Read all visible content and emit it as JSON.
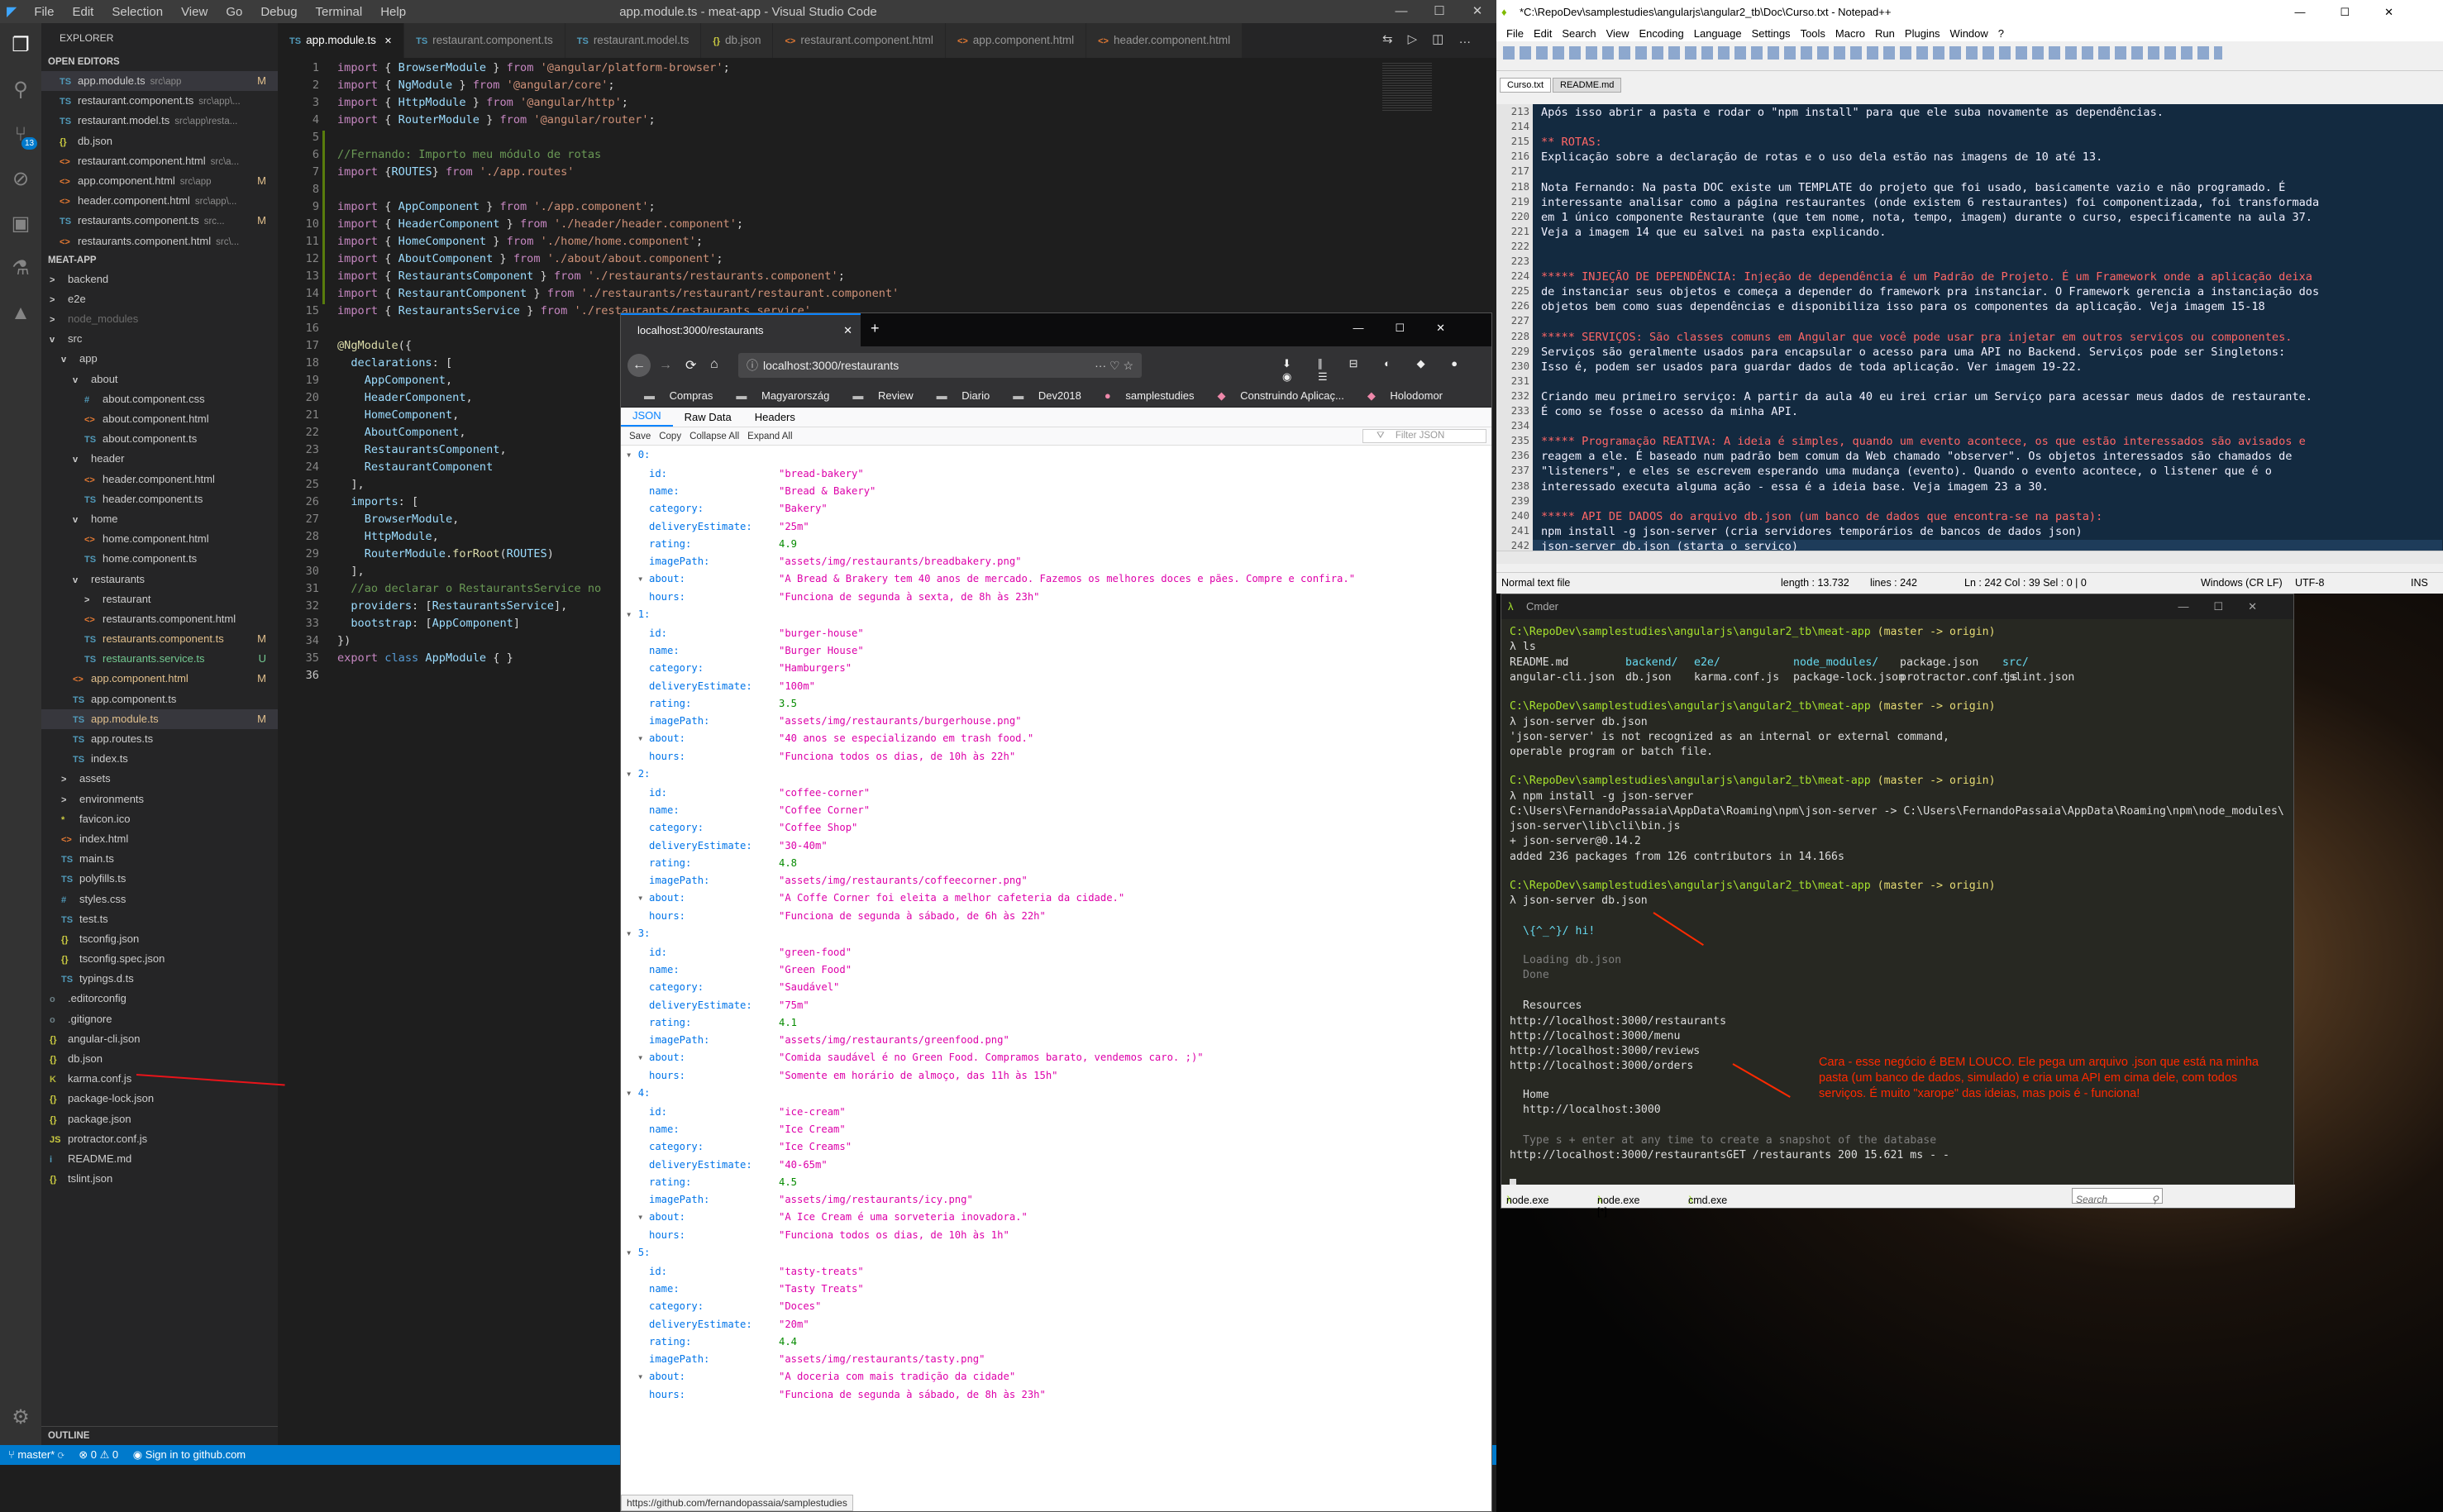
{
  "vscode": {
    "menu": [
      "File",
      "Edit",
      "Selection",
      "View",
      "Go",
      "Debug",
      "Terminal",
      "Help"
    ],
    "window_title": "app.module.ts - meat-app - Visual Studio Code",
    "badge": "13",
    "explorer_label": "EXPLORER",
    "open_editors_label": "OPEN EDITORS",
    "open_editors": [
      {
        "icon": "TS",
        "name": "app.module.ts",
        "path": "src\\app",
        "mark": "M"
      },
      {
        "icon": "TS",
        "name": "restaurant.component.ts",
        "path": "src\\app\\...",
        "mark": ""
      },
      {
        "icon": "TS",
        "name": "restaurant.model.ts",
        "path": "src\\app\\resta...",
        "mark": ""
      },
      {
        "icon": "{}",
        "name": "db.json",
        "path": "",
        "mark": ""
      },
      {
        "icon": "<>",
        "name": "restaurant.component.html",
        "path": "src\\a...",
        "mark": ""
      },
      {
        "icon": "<>",
        "name": "app.component.html",
        "path": "src\\app",
        "mark": "M"
      },
      {
        "icon": "<>",
        "name": "header.component.html",
        "path": "src\\app\\...",
        "mark": ""
      },
      {
        "icon": "TS",
        "name": "restaurants.component.ts",
        "path": "src...",
        "mark": "M"
      },
      {
        "icon": "<>",
        "name": "restaurants.component.html",
        "path": "src\\...",
        "mark": ""
      }
    ],
    "project_label": "MEAT-APP",
    "tree": [
      {
        "d": 0,
        "icon": ">",
        "name": "backend"
      },
      {
        "d": 0,
        "icon": ">",
        "name": "e2e"
      },
      {
        "d": 0,
        "icon": ">",
        "name": "node_modules"
      },
      {
        "d": 0,
        "icon": "v",
        "name": "src"
      },
      {
        "d": 1,
        "icon": "v",
        "name": "app"
      },
      {
        "d": 2,
        "icon": "v",
        "name": "about"
      },
      {
        "d": 3,
        "icon": "#",
        "name": "about.component.css"
      },
      {
        "d": 3,
        "icon": "<>",
        "name": "about.component.html"
      },
      {
        "d": 3,
        "icon": "TS",
        "name": "about.component.ts"
      },
      {
        "d": 2,
        "icon": "v",
        "name": "header"
      },
      {
        "d": 3,
        "icon": "<>",
        "name": "header.component.html"
      },
      {
        "d": 3,
        "icon": "TS",
        "name": "header.component.ts"
      },
      {
        "d": 2,
        "icon": "v",
        "name": "home"
      },
      {
        "d": 3,
        "icon": "<>",
        "name": "home.component.html"
      },
      {
        "d": 3,
        "icon": "TS",
        "name": "home.component.ts"
      },
      {
        "d": 2,
        "icon": "v",
        "name": "restaurants"
      },
      {
        "d": 3,
        "icon": ">",
        "name": "restaurant"
      },
      {
        "d": 3,
        "icon": "<>",
        "name": "restaurants.component.html"
      },
      {
        "d": 3,
        "icon": "TS",
        "name": "restaurants.component.ts",
        "mark": "M"
      },
      {
        "d": 3,
        "icon": "TS",
        "name": "restaurants.service.ts",
        "mark": "U"
      },
      {
        "d": 2,
        "icon": "<>",
        "name": "app.component.html",
        "mark": "M"
      },
      {
        "d": 2,
        "icon": "TS",
        "name": "app.component.ts"
      },
      {
        "d": 2,
        "icon": "TS",
        "name": "app.module.ts",
        "mark": "M"
      },
      {
        "d": 2,
        "icon": "TS",
        "name": "app.routes.ts"
      },
      {
        "d": 2,
        "icon": "TS",
        "name": "index.ts"
      },
      {
        "d": 1,
        "icon": ">",
        "name": "assets"
      },
      {
        "d": 1,
        "icon": ">",
        "name": "environments"
      },
      {
        "d": 1,
        "icon": "*",
        "name": "favicon.ico"
      },
      {
        "d": 1,
        "icon": "<>",
        "name": "index.html"
      },
      {
        "d": 1,
        "icon": "TS",
        "name": "main.ts"
      },
      {
        "d": 1,
        "icon": "TS",
        "name": "polyfills.ts"
      },
      {
        "d": 1,
        "icon": "#",
        "name": "styles.css"
      },
      {
        "d": 1,
        "icon": "TS",
        "name": "test.ts"
      },
      {
        "d": 1,
        "icon": "{}",
        "name": "tsconfig.json"
      },
      {
        "d": 1,
        "icon": "{}",
        "name": "tsconfig.spec.json"
      },
      {
        "d": 1,
        "icon": "TS",
        "name": "typings.d.ts"
      },
      {
        "d": 0,
        "icon": "o",
        "name": ".editorconfig"
      },
      {
        "d": 0,
        "icon": "o",
        "name": ".gitignore"
      },
      {
        "d": 0,
        "icon": "{}",
        "name": "angular-cli.json"
      },
      {
        "d": 0,
        "icon": "{}",
        "name": "db.json"
      },
      {
        "d": 0,
        "icon": "K",
        "name": "karma.conf.js"
      },
      {
        "d": 0,
        "icon": "{}",
        "name": "package-lock.json"
      },
      {
        "d": 0,
        "icon": "{}",
        "name": "package.json"
      },
      {
        "d": 0,
        "icon": "JS",
        "name": "protractor.conf.js"
      },
      {
        "d": 0,
        "icon": "i",
        "name": "README.md"
      },
      {
        "d": 0,
        "icon": "{}",
        "name": "tslint.json"
      }
    ],
    "outline_label": "OUTLINE",
    "tabs": [
      "app.module.ts",
      "restaurant.component.ts",
      "restaurant.model.ts",
      "db.json",
      "restaurant.component.html",
      "app.component.html",
      "header.component.html"
    ],
    "status": {
      "branch": "master*",
      "errors": "0",
      "warnings": "0",
      "signin": "Sign in to github.com"
    }
  },
  "code": [
    "import { BrowserModule } from '@angular/platform-browser';",
    "import { NgModule } from '@angular/core';",
    "import { HttpModule } from '@angular/http';",
    "import { RouterModule } from '@angular/router';",
    "",
    "//Fernando: Importo meu módulo de rotas",
    "import {ROUTES} from './app.routes'",
    "",
    "import { AppComponent } from './app.component';",
    "import { HeaderComponent } from './header/header.component';",
    "import { HomeComponent } from './home/home.component';",
    "import { AboutComponent } from './about/about.component';",
    "import { RestaurantsComponent } from './restaurants/restaurants.component';",
    "import { RestaurantComponent } from './restaurants/restaurant/restaurant.component'",
    "import { RestaurantsService } from './restaurants/restaurants.service'",
    "",
    "@NgModule({",
    "  declarations: [",
    "    AppComponent,",
    "    HeaderComponent,",
    "    HomeComponent,",
    "    AboutComponent,",
    "    RestaurantsComponent,",
    "    RestaurantComponent",
    "  ],",
    "  imports: [",
    "    BrowserModule,",
    "    HttpModule,",
    "    RouterModule.forRoot(ROUTES)",
    "  ],",
    "  //ao declarar o RestaurantsService no",
    "  providers: [RestaurantsService],",
    "  bootstrap: [AppComponent]",
    "})",
    "export class AppModule { }",
    ""
  ],
  "firefox": {
    "tab_title": "localhost:3000/restaurants",
    "url": "localhost:3000/restaurants",
    "bookmarks": [
      "Compras",
      "Magyarország",
      "Review",
      "Diario",
      "Dev2018",
      "samplestudies",
      "Construindo Aplicaç...",
      "Holodomor"
    ],
    "viewer_tabs": [
      "JSON",
      "Raw Data",
      "Headers"
    ],
    "toolbar": [
      "Save",
      "Copy",
      "Collapse All",
      "Expand All"
    ],
    "filter_placeholder": "Filter JSON",
    "status_url": "https://github.com/fernandopassaia/samplestudies",
    "restaurants": [
      {
        "id": "\"bread-bakery\"",
        "name": "\"Bread & Bakery\"",
        "category": "\"Bakery\"",
        "deliveryEstimate": "\"25m\"",
        "rating": "4.9",
        "imagePath": "\"assets/img/restaurants/breadbakery.png\"",
        "about": "\"A Bread & Brakery tem 40 anos de mercado. Fazemos os melhores doces e pães. Compre e confira.\"",
        "hours": "\"Funciona de segunda à sexta, de 8h às 23h\""
      },
      {
        "id": "\"burger-house\"",
        "name": "\"Burger House\"",
        "category": "\"Hamburgers\"",
        "deliveryEstimate": "\"100m\"",
        "rating": "3.5",
        "imagePath": "\"assets/img/restaurants/burgerhouse.png\"",
        "about": "\"40 anos se especializando em trash food.\"",
        "hours": "\"Funciona todos os dias, de 10h às 22h\""
      },
      {
        "id": "\"coffee-corner\"",
        "name": "\"Coffee Corner\"",
        "category": "\"Coffee Shop\"",
        "deliveryEstimate": "\"30-40m\"",
        "rating": "4.8",
        "imagePath": "\"assets/img/restaurants/coffeecorner.png\"",
        "about": "\"A Coffe Corner foi eleita a melhor cafeteria da cidade.\"",
        "hours": "\"Funciona de segunda à sábado, de 6h às 22h\""
      },
      {
        "id": "\"green-food\"",
        "name": "\"Green Food\"",
        "category": "\"Saudável\"",
        "deliveryEstimate": "\"75m\"",
        "rating": "4.1",
        "imagePath": "\"assets/img/restaurants/greenfood.png\"",
        "about": "\"Comida saudável é no Green Food. Compramos barato, vendemos caro. ;)\"",
        "hours": "\"Somente em horário de almoço, das 11h às 15h\""
      },
      {
        "id": "\"ice-cream\"",
        "name": "\"Ice Cream\"",
        "category": "\"Ice Creams\"",
        "deliveryEstimate": "\"40-65m\"",
        "rating": "4.5",
        "imagePath": "\"assets/img/restaurants/icy.png\"",
        "about": "\"A Ice Cream é uma sorveteria inovadora.\"",
        "hours": "\"Funciona todos os dias, de 10h às 1h\""
      },
      {
        "id": "\"tasty-treats\"",
        "name": "\"Tasty Treats\"",
        "category": "\"Doces\"",
        "deliveryEstimate": "\"20m\"",
        "rating": "4.4",
        "imagePath": "\"assets/img/restaurants/tasty.png\"",
        "about": "\"A doceria com mais tradição da cidade\"",
        "hours": "\"Funciona de segunda à sábado, de 8h às 23h\""
      }
    ]
  },
  "notepadpp": {
    "title": "*C:\\RepoDev\\samplestudies\\angularjs\\angular2_tb\\Doc\\Curso.txt - Notepad++",
    "menu": [
      "File",
      "Edit",
      "Search",
      "View",
      "Encoding",
      "Language",
      "Settings",
      "Tools",
      "Macro",
      "Run",
      "Plugins",
      "Window",
      "?"
    ],
    "tabs": [
      "Curso.txt",
      "README.md"
    ],
    "lines": [
      {
        "n": "213",
        "t": "Após isso abrir a pasta e rodar o \"npm install\" para que ele suba novamente as dependências."
      },
      {
        "n": "214",
        "t": ""
      },
      {
        "n": "215",
        "t": "** ROTAS:"
      },
      {
        "n": "216",
        "t": "Explicação sobre a declaração de rotas e o uso dela estão nas imagens de 10 até 13."
      },
      {
        "n": "217",
        "t": ""
      },
      {
        "n": "218",
        "t": "Nota Fernando: Na pasta DOC existe um TEMPLATE do projeto que foi usado, basicamente vazio e não programado. É"
      },
      {
        "n": "219",
        "t": "interessante analisar como a página restaurantes (onde existem 6 restaurantes) foi componentizada, foi transformada"
      },
      {
        "n": "220",
        "t": "em 1 único componente Restaurante (que tem nome, nota, tempo, imagem) durante o curso, especificamente na aula 37."
      },
      {
        "n": "221",
        "t": "Veja a imagem 14 que eu salvei na pasta explicando."
      },
      {
        "n": "222",
        "t": ""
      },
      {
        "n": "223",
        "t": ""
      },
      {
        "n": "224",
        "t": "***** INJEÇÃO DE DEPENDÊNCIA: Injeção de dependência é um Padrão de Projeto. É um Framework onde a aplicação deixa"
      },
      {
        "n": "225",
        "t": "de instanciar seus objetos e começa a depender do framework pra instanciar. O Framework gerencia a instanciação dos"
      },
      {
        "n": "226",
        "t": "objetos bem como suas dependências e disponibiliza isso para os componentes da aplicação. Veja imagem 15-18"
      },
      {
        "n": "227",
        "t": ""
      },
      {
        "n": "228",
        "t": "***** SERVIÇOS: São classes comuns em Angular que você pode usar pra injetar em outros serviços ou componentes."
      },
      {
        "n": "229",
        "t": "Serviços são geralmente usados para encapsular o acesso para uma API no Backend. Serviços pode ser Singletons:"
      },
      {
        "n": "230",
        "t": "Isso é, podem ser usados para guardar dados de toda aplicação. Ver imagem 19-22."
      },
      {
        "n": "231",
        "t": ""
      },
      {
        "n": "232",
        "t": "Criando meu primeiro serviço: A partir da aula 40 eu irei criar um Serviço para acessar meus dados de restaurante."
      },
      {
        "n": "233",
        "t": "É como se fosse o acesso da minha API."
      },
      {
        "n": "234",
        "t": ""
      },
      {
        "n": "235",
        "t": "***** Programação REATIVA: A ideia é simples, quando um evento acontece, os que estão interessados são avisados e"
      },
      {
        "n": "236",
        "t": "reagem a ele. É baseado num padrão bem comum da Web chamado \"observer\". Os objetos interessados são chamados de"
      },
      {
        "n": "237",
        "t": "\"listeners\", e eles se escrevem esperando uma mudança (evento). Quando o evento acontece, o listener que é o"
      },
      {
        "n": "238",
        "t": "interessado executa alguma ação - essa é a ideia base. Veja imagem 23 a 30."
      },
      {
        "n": "239",
        "t": ""
      },
      {
        "n": "240",
        "t": "***** API DE DADOS do arquivo db.json (um banco de dados que encontra-se na pasta):"
      },
      {
        "n": "241",
        "t": "npm install -g json-server (cria servidores temporários de bancos de dados json)"
      },
      {
        "n": "242",
        "t": "json-server db.json (starta o serviço)"
      }
    ],
    "status": {
      "type": "Normal text file",
      "length": "length : 13.732",
      "lines": "lines : 242",
      "pos": "Ln : 242    Col : 39    Sel : 0 | 0",
      "eol": "Windows (CR LF)",
      "enc": "UTF-8",
      "mode": "INS"
    }
  },
  "cmder": {
    "title": "Cmder",
    "prompt_path": "C:\\RepoDev\\samplestudies\\angularjs\\angular2_tb\\meat-app",
    "branch": "(master -> origin)",
    "ls_row1": [
      "README.md",
      "backend/",
      "e2e/",
      "node_modules/",
      "package.json",
      "src/"
    ],
    "ls_row2": [
      "angular-cli.json",
      "db.json",
      "karma.conf.js",
      "package-lock.json",
      "protractor.conf.js",
      "tslint.json"
    ],
    "cmd1": "λ ls",
    "cmd2": "λ json-server db.json",
    "err1": "'json-server' is not recognized as an internal or external command,",
    "err2": "operable program or batch file.",
    "cmd3": "λ npm install -g json-server",
    "npm1": "C:\\Users\\FernandoPassaia\\AppData\\Roaming\\npm\\json-server -> C:\\Users\\FernandoPassaia\\AppData\\Roaming\\npm\\node_modules\\",
    "npm2": "json-server\\lib\\cli\\bin.js",
    "npm3": "+ json-server@0.14.2",
    "npm4": "added 236 packages from 126 contributors in 14.166s",
    "cmd4": "λ json-server db.json",
    "hi": "\\{^_^}/ hi!",
    "loading": "Loading db.json",
    "done": "Done",
    "resources_label": "Resources",
    "resources": [
      "http://localhost:3000/restaurants",
      "http://localhost:3000/menu",
      "http://localhost:3000/reviews",
      "http://localhost:3000/orders"
    ],
    "home_label": "Home",
    "home_url": "http://localhost:3000",
    "hint": "Type s + enter at any time to create a snapshot of the database",
    "log": "http://localhost:3000/restaurantsGET /restaurants 200 15.621 ms - -",
    "tabs": [
      "node.exe",
      "node.exe [*]",
      "cmd.exe"
    ],
    "search_placeholder": "Search",
    "note": "Cara - esse negócio é BEM LOUCO. Ele pega um arquivo .json que está na minha pasta (um banco de dados, simulado) e cria uma API em cima dele, com todos serviços. É muito \"xarope\" das ideias, mas pois é - funciona!"
  },
  "colors": {
    "vscode_bg": "#1e1e1e",
    "status_blue": "#007acc",
    "annotation_red": "#ff2a00",
    "npp_bg": "#132a40",
    "cmder_bg": "#272822"
  }
}
